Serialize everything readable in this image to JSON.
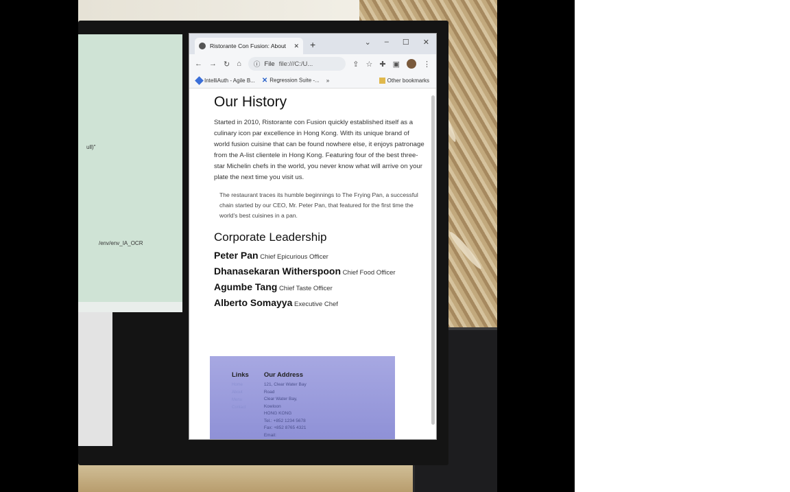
{
  "browser": {
    "tab_title": "Ristorante Con Fusion: About",
    "new_tab": "+",
    "omnibox": {
      "scheme": "File",
      "url": "file:///C:/U..."
    },
    "bookmarks": [
      {
        "label": "IntelliAuth - Agile B...",
        "icon_color": "#3b6fd8"
      },
      {
        "label": "Regression Suite -...",
        "icon_color": "#2a62c9"
      }
    ],
    "bookmarks_more": "»",
    "other_bookmarks": "Other bookmarks"
  },
  "page": {
    "history_title": "Our History",
    "history_text": "Started in 2010, Ristorante con Fusion quickly established itself as a culinary icon par excellence in Hong Kong. With its unique brand of world fusion cuisine that can be found nowhere else, it enjoys patronage from the A-list clientele in Hong Kong. Featuring four of the best three-star Michelin chefs in the world, you never know what will arrive on your plate the next time you visit us.",
    "history_quote": "The restaurant traces its humble beginnings to The Frying Pan, a successful chain started by our CEO, Mr. Peter Pan, that featured for the first time the world's best cuisines in a pan.",
    "leadership_title": "Corporate Leadership",
    "leaders": [
      {
        "name": "Peter Pan",
        "role": "Chief Epicurious Officer"
      },
      {
        "name": "Dhanasekaran Witherspoon",
        "role": "Chief Food Officer"
      },
      {
        "name": "Agumbe Tang",
        "role": "Chief Taste Officer"
      },
      {
        "name": "Alberto Somayya",
        "role": "Executive Chef"
      }
    ]
  },
  "footer": {
    "links_title": "Links",
    "links": [
      "Home",
      "About",
      "Menu",
      "Contact"
    ],
    "address_title": "Our Address",
    "address_lines": [
      "121, Clear Water Bay",
      "Road",
      "Clear Water Bay,",
      "Kowloon",
      "HONG KONG",
      "Tel.: +852 1234 5678",
      "Fax: +852 8765 4321",
      "Email:"
    ]
  },
  "desktop": {
    "left_text_1": "ull)\"",
    "left_text_2": "/env/env_IA_OCR"
  },
  "colors": {
    "footer_gradient_top": "#a7a8e2",
    "footer_gradient_bottom": "#8e90d6",
    "left_window": "#cfe3d5"
  }
}
